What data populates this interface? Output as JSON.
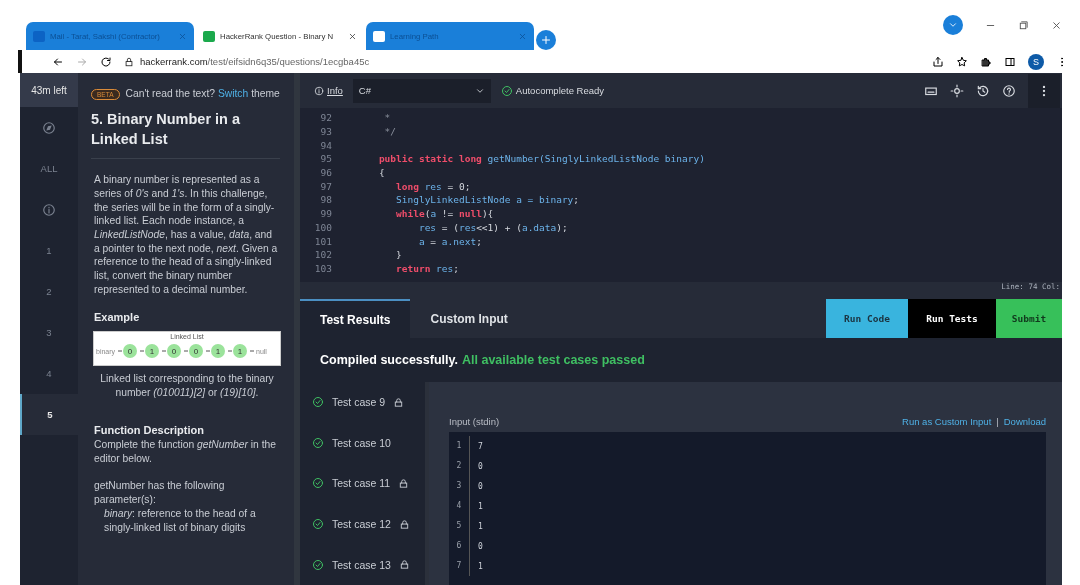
{
  "browser": {
    "tabs": [
      {
        "title": "Mail - Tarat, Sakshi (Contractor)",
        "selected": false,
        "kind": "mail"
      },
      {
        "title": "HackerRank Question - Binary N",
        "selected": true,
        "kind": "hr"
      },
      {
        "title": "Learning Path",
        "selected": false,
        "kind": "c"
      }
    ],
    "url_host": "hackerrank.com",
    "url_path": "/test/eifsidn6q35/questions/1ecgba45c",
    "profile": "S"
  },
  "nav": {
    "timer": "43m left",
    "items": [
      {
        "kind": "compass",
        "selected": false
      },
      {
        "kind": "text",
        "label": "ALL",
        "selected": false
      },
      {
        "kind": "info",
        "selected": false
      },
      {
        "kind": "number",
        "label": "1",
        "selected": false
      },
      {
        "kind": "number",
        "label": "2",
        "selected": false
      },
      {
        "kind": "number",
        "label": "3",
        "selected": false
      },
      {
        "kind": "number",
        "label": "4",
        "selected": false
      },
      {
        "kind": "number",
        "label": "5",
        "selected": true
      }
    ]
  },
  "problem": {
    "beta": "BETA",
    "theme_prompt": "Can't read the text?",
    "theme_link": "Switch",
    "theme_suffix": "theme",
    "title": "5. Binary Number in a Linked List",
    "description": "A binary number is represented as a series of *0's* and *1's*. In this challenge, the series will be in the form of a singly-linked list. Each node instance, a *LinkedListNode*, has a value, *data*, and a pointer to the next node, *next*. Given a reference to the head of a singly-linked list, convert the binary number represented to a decimal number.",
    "example_heading": "Example",
    "diagram": {
      "title": "Linked List",
      "head": "binary",
      "nodes": [
        "0",
        "1",
        "0",
        "0",
        "1",
        "1"
      ],
      "tail": "null"
    },
    "caption": "Linked list corresponding to the binary number *(010011)[2]* or *(19)[10]*.",
    "function_heading": "Function Description",
    "function_text": "Complete the function *getNumber* in the editor below.",
    "params_intro": "getNumber has the following parameter(s):",
    "param": "*binary*:  reference to the head of a singly-linked list of binary digits"
  },
  "editor": {
    "info": "Info",
    "language": "C#",
    "autocomplete": "Autocomplete Ready",
    "lines": [
      {
        "n": "92",
        "tokens": [
          {
            "kind": "comment",
            "text": "     *"
          }
        ]
      },
      {
        "n": "93",
        "tokens": [
          {
            "kind": "comment",
            "text": "     */"
          }
        ]
      },
      {
        "n": "94"
      },
      {
        "n": "95",
        "tokens": [
          {
            "kind": "keyword",
            "text": "    public static long "
          },
          {
            "kind": "type",
            "text": "getNumber(SinglyLinkedListNode binary)"
          }
        ]
      },
      {
        "n": "96",
        "tokens": [
          {
            "kind": "plain",
            "text": "    {"
          }
        ]
      },
      {
        "n": "97",
        "tokens": [
          {
            "kind": "keyword",
            "text": "       long "
          },
          {
            "kind": "type",
            "text": "res"
          },
          {
            "kind": "plain",
            "text": " = 0;"
          }
        ]
      },
      {
        "n": "98",
        "tokens": [
          {
            "kind": "type",
            "text": "       SinglyLinkedListNode a = binary"
          },
          {
            "kind": "plain",
            "text": ";"
          }
        ]
      },
      {
        "n": "99",
        "tokens": [
          {
            "kind": "keyword",
            "text": "       while"
          },
          {
            "kind": "plain",
            "text": "("
          },
          {
            "kind": "type",
            "text": "a"
          },
          {
            "kind": "plain",
            "text": " != "
          },
          {
            "kind": "keyword",
            "text": "null"
          },
          {
            "kind": "plain",
            "text": "){"
          }
        ]
      },
      {
        "n": "100",
        "tokens": [
          {
            "kind": "type",
            "text": "           res"
          },
          {
            "kind": "plain",
            "text": " = ("
          },
          {
            "kind": "type",
            "text": "res"
          },
          {
            "kind": "plain",
            "text": "<<1) + ("
          },
          {
            "kind": "type",
            "text": "a.data"
          },
          {
            "kind": "plain",
            "text": ");"
          }
        ]
      },
      {
        "n": "101",
        "tokens": [
          {
            "kind": "type",
            "text": "           a"
          },
          {
            "kind": "plain",
            "text": " = "
          },
          {
            "kind": "type",
            "text": "a.next"
          },
          {
            "kind": "plain",
            "text": ";"
          }
        ]
      },
      {
        "n": "102",
        "tokens": [
          {
            "kind": "plain",
            "text": "       }"
          }
        ]
      },
      {
        "n": "103",
        "tokens": [
          {
            "kind": "keyword",
            "text": "       return "
          },
          {
            "kind": "type",
            "text": "res"
          },
          {
            "kind": "plain",
            "text": ";"
          }
        ]
      }
    ],
    "status": "Line: 74 Col:"
  },
  "results": {
    "tabs": [
      {
        "label": "Test Results",
        "selected": true
      },
      {
        "label": "Custom Input",
        "selected": false
      }
    ],
    "buttons": [
      {
        "label": "Run Code",
        "kind": "run"
      },
      {
        "label": "Run Tests",
        "kind": "tests"
      },
      {
        "label": "Submit",
        "kind": "submit"
      }
    ],
    "compiled": "Compiled successfully.",
    "passed": "All available test cases passed",
    "cases": [
      {
        "label": "Test case 9",
        "locked": true,
        "passed": true
      },
      {
        "label": "Test case 10",
        "locked": false,
        "passed": true
      },
      {
        "label": "Test case 11",
        "locked": true,
        "passed": true
      },
      {
        "label": "Test case 12",
        "locked": true,
        "passed": true
      },
      {
        "label": "Test case 13",
        "locked": true,
        "passed": true
      }
    ],
    "input_label": "Input (stdin)",
    "run_custom": "Run as Custom Input",
    "separator": "|",
    "download": "Download",
    "stdin": [
      {
        "n": "1",
        "v": "7"
      },
      {
        "n": "2",
        "v": "0"
      },
      {
        "n": "3",
        "v": "0"
      },
      {
        "n": "4",
        "v": "1"
      },
      {
        "n": "5",
        "v": "1"
      },
      {
        "n": "6",
        "v": "0"
      },
      {
        "n": "7",
        "v": "1"
      }
    ]
  }
}
